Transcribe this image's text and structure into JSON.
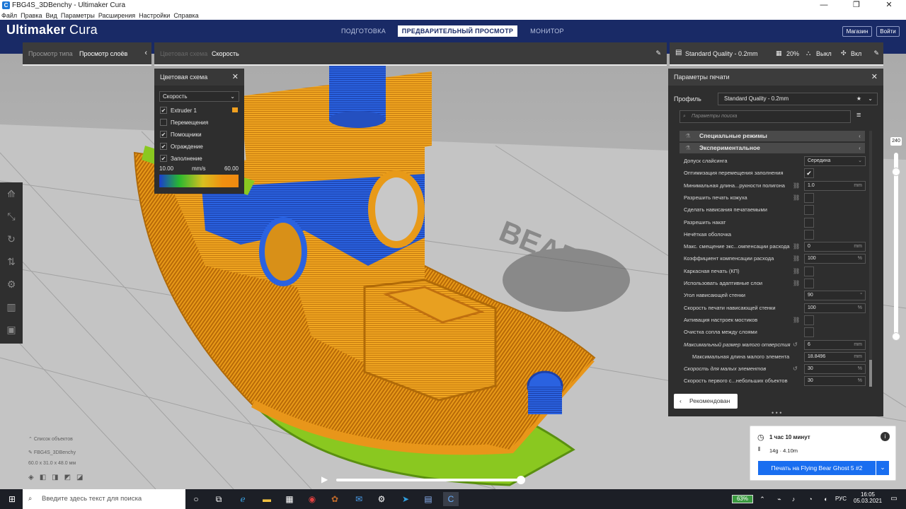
{
  "window": {
    "app_icon": "C",
    "title": "FBG4S_3DBenchy - Ultimaker Cura",
    "buttons": [
      "—",
      "❐",
      "✕"
    ]
  },
  "menu": [
    "Файл",
    "Правка",
    "Вид",
    "Параметры",
    "Расширения",
    "Настройки",
    "Справка"
  ],
  "header": {
    "logo_a": "Ultimaker",
    "logo_b": "Cura",
    "stages": [
      "ПОДГОТОВКА",
      "ПРЕДВАРИТЕЛЬНЫЙ ПРОСМОТР",
      "МОНИТОР"
    ],
    "shop": "Магазин",
    "signin": "Войти"
  },
  "viewbar": {
    "label": "Просмотр типа",
    "value": "Просмотр слоёв",
    "scheme_label": "Цветовая схема",
    "scheme_value": "Скорость"
  },
  "printbar": {
    "profile": "Standard Quality - 0.2mm",
    "infill": "20%",
    "support": "Выкл",
    "adhesion": "Вкл"
  },
  "colorscheme": {
    "title": "Цветовая схема",
    "select": "Скорость",
    "items": [
      {
        "label": "Extruder 1",
        "checked": true
      },
      {
        "label": "Перемещения",
        "checked": false
      },
      {
        "label": "Помощники",
        "checked": true
      },
      {
        "label": "Ограждение",
        "checked": true
      },
      {
        "label": "Заполнение",
        "checked": true
      }
    ],
    "min": "10.00",
    "unit": "mm/s",
    "max": "60.00"
  },
  "settings": {
    "title": "Параметры печати",
    "profile_label": "Профиль",
    "profile_value": "Standard Quality - 0.2mm",
    "search_placeholder": "Параметры поиска",
    "categories": [
      "Специальные режимы",
      "Экспериментальное"
    ],
    "rows": [
      {
        "label": "Допуск слайсинга",
        "type": "select",
        "value": "Середина"
      },
      {
        "label": "Оптимизация перемещения заполнения",
        "type": "check",
        "value": "✔"
      },
      {
        "label": "Минимальная длина...рукности полигона",
        "type": "input",
        "value": "1.0",
        "unit": "mm",
        "link": true
      },
      {
        "label": "Разрешить печать кожуха",
        "type": "check",
        "value": "",
        "link": true
      },
      {
        "label": "Сделать нависания печатаемыми",
        "type": "check",
        "value": ""
      },
      {
        "label": "Разрешить накат",
        "type": "check",
        "value": ""
      },
      {
        "label": "Нечёткая оболочка",
        "type": "check",
        "value": ""
      },
      {
        "label": "Макс. смещение экс...омпенсации расхода",
        "type": "input",
        "value": "0",
        "unit": "mm",
        "link": true
      },
      {
        "label": "Коэффициент компенсации расхода",
        "type": "input",
        "value": "100",
        "unit": "%",
        "link": true
      },
      {
        "label": "Каркасная печать (КП)",
        "type": "check",
        "value": "",
        "link": true
      },
      {
        "label": "Использовать адаптивные слои",
        "type": "check",
        "value": "",
        "link": true
      },
      {
        "label": "Угол нависающей стенки",
        "type": "input",
        "value": "90",
        "unit": "°"
      },
      {
        "label": "Скорость печати нависающей стенки",
        "type": "input",
        "value": "100",
        "unit": "%"
      },
      {
        "label": "Активация настроек мостиков",
        "type": "check",
        "value": "",
        "link": true
      },
      {
        "label": "Очистка сопла между слоями",
        "type": "check",
        "value": ""
      },
      {
        "label": "Максимальный размер малого отверстия",
        "type": "input",
        "value": "6",
        "unit": "mm",
        "italic": true,
        "reset": true
      },
      {
        "label": "Максимальная длина малого элемента",
        "type": "input",
        "value": "18.8496",
        "unit": "mm",
        "indent": true
      },
      {
        "label": "Скорость для малых элементов",
        "type": "input",
        "value": "30",
        "unit": "%",
        "italic": true,
        "reset": true
      },
      {
        "label": "Скорость первого с...небольших объектов",
        "type": "input",
        "value": "30",
        "unit": "%"
      }
    ],
    "recommended": "Рекомендован"
  },
  "layer_slider": {
    "value": "240",
    "fraction": 0.92
  },
  "objects": {
    "title": "Список объектов",
    "name": "FBG4S_3DBenchy",
    "size": "60.0 x 31.0 x 48.0 мм"
  },
  "playback": {
    "fraction": 1.0
  },
  "printjob": {
    "time": "1 час 10 минут",
    "material": "14g · 4.10m",
    "button": "Печать на Flying Bear Ghost 5 #2"
  },
  "taskbar": {
    "search_placeholder": "Введите здесь текст для поиска",
    "battery": "63%",
    "lang": "РУС",
    "time": "16:05",
    "date": "05.03.2021"
  },
  "colors": {
    "header": "#192a66",
    "accent": "#196ef0",
    "panel": "#2e2e2e",
    "orange": "#f0a020",
    "blue": "#2a58d8"
  }
}
